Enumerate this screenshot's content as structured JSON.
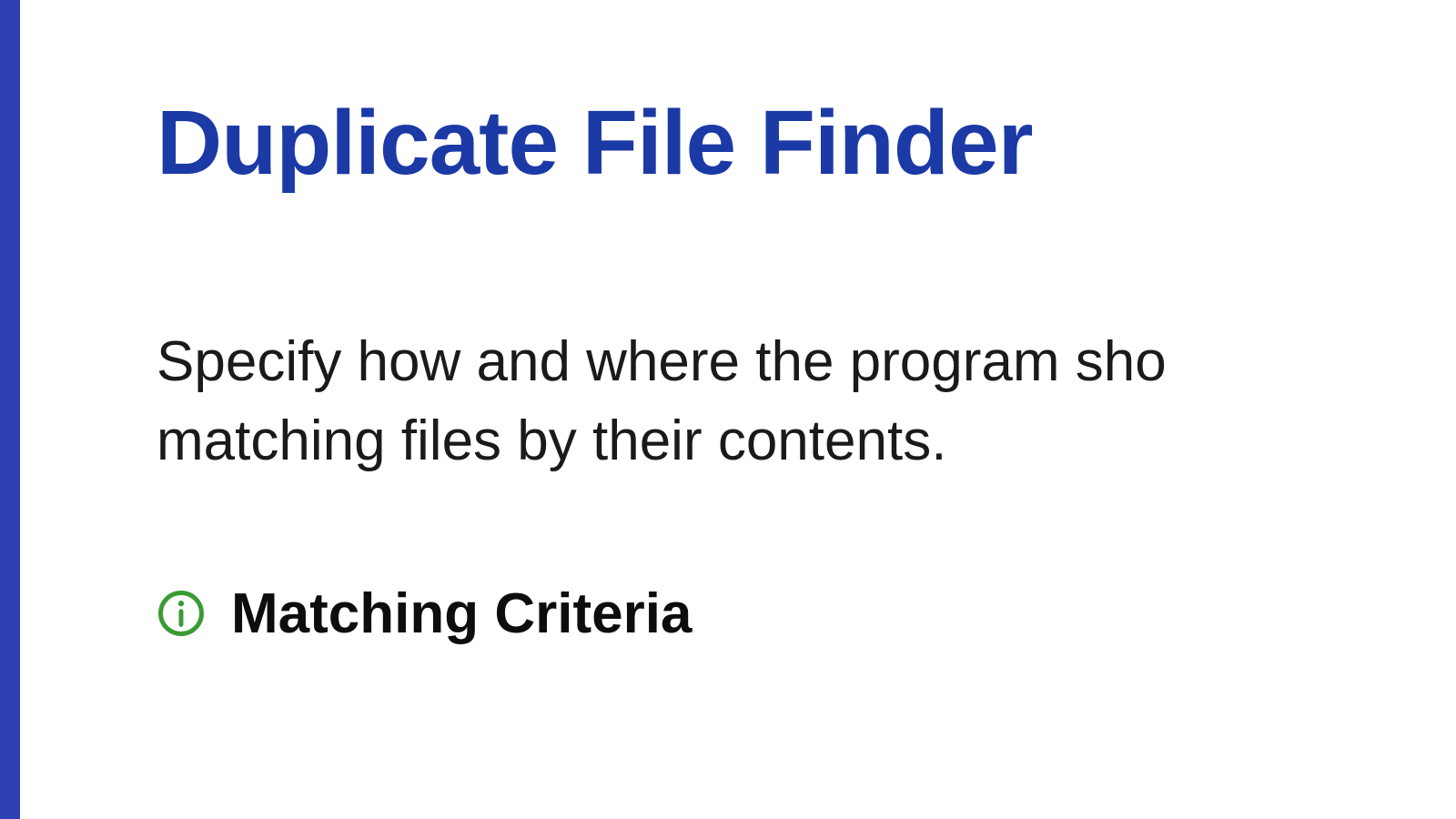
{
  "page": {
    "title": "Duplicate File Finder",
    "description_line1": "Specify how and where the program sho",
    "description_line2": "matching files by their contents."
  },
  "section": {
    "matching_criteria": {
      "label": "Matching Criteria",
      "icon": "info-icon"
    }
  },
  "colors": {
    "accent_blue": "#1b3aa6",
    "border_blue": "#2c3fb3",
    "icon_green": "#3a9b34",
    "text": "#1a1a1a"
  }
}
